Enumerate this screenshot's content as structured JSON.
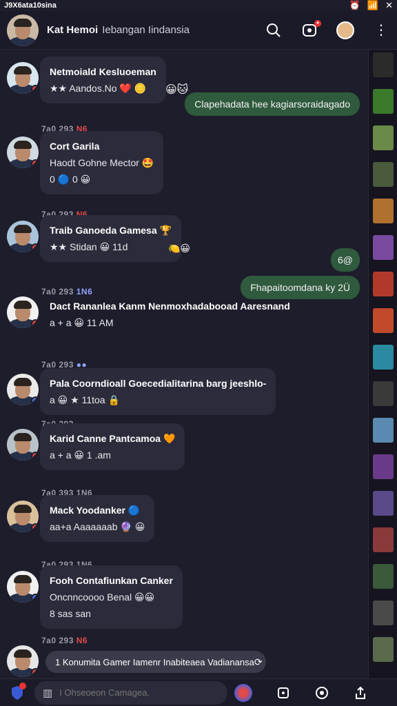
{
  "status_bar": {
    "time": "J9X6ata10sina",
    "icons": [
      "alarm-icon",
      "wifi-icon",
      "close-icon"
    ]
  },
  "header": {
    "name": "Kat Hemoi",
    "subtitle": "Iebangan Iindansia"
  },
  "colors": {
    "background": "#1e1d2b",
    "bubble": "#2c2b3b",
    "sent_bubble": "#2f5a3d",
    "accent_red": "#e24646"
  },
  "messages": [
    {
      "sender": "Netmoiald Kesluoeman",
      "line1": "★★ Aandos.No ❤️ 🪙",
      "line2": "",
      "badge": "red"
    },
    {
      "sender": "Cort Garila",
      "line1": "Haodt Gohne Mector 🤩",
      "line2": "0 🔵 0 😀",
      "badge": "red"
    },
    {
      "sender": "Traib Ganoeda Gamesa 🏆",
      "line1": "★★ Stidan 😀 11d",
      "line2": "",
      "badge": "red"
    },
    {
      "sender": "Dact Rananlea Kanm Nenmoxhadabooad Aaresnand",
      "line1": "a + a 😀 11 AM",
      "line2": "",
      "badge": "red"
    },
    {
      "sender": "Pala Coorndioall Goecedialitarina barg jeeshlo-",
      "line1": "a 😀 ★ 11toa 🔒",
      "line2": "",
      "badge": "blue"
    },
    {
      "sender": "Karid Canne Pantcamoa 🧡",
      "line1": "a + a 😀 1 .am",
      "line2": "",
      "badge": "red"
    },
    {
      "sender": "Mack Yoodanker 🔵",
      "line1": "aa+a Aaaaaaab 🔮 😀",
      "line2": "",
      "badge": "red"
    },
    {
      "sender": "Fooh Contafiunkan Canker",
      "line1": "Oncnncoooo Benal 😀😀",
      "line2": "8 sas san",
      "badge": "blue"
    },
    {
      "sender": "",
      "line1": "",
      "line2": "",
      "badge": "red"
    }
  ],
  "date_separators": [
    {
      "text": "7a0 293",
      "tag": "N6",
      "tag_color": "red"
    },
    {
      "text": "7a0 293",
      "tag": "N6",
      "tag_color": "red"
    },
    {
      "text": "7a0 293",
      "tag": "1N6",
      "tag_color": "blue"
    },
    {
      "text": "7a0 293",
      "tag": "●●",
      "tag_color": "blue"
    },
    {
      "text": "7a0 293",
      "tag": "",
      "tag_color": "blue"
    },
    {
      "text": "7a0 393 1N6",
      "tag": "",
      "tag_color": "blue"
    },
    {
      "text": "7a0 293 1N6",
      "tag": "",
      "tag_color": "blue"
    },
    {
      "text": "7a0 293",
      "tag": "N6",
      "tag_color": "red"
    }
  ],
  "sent": [
    {
      "text": "Clapehadata hee kagiarsoraidagado"
    },
    {
      "text": "6@"
    },
    {
      "text": "Fhapaitoomdana ky 2Ü"
    }
  ],
  "emoji_extras": [
    "😀🐱",
    "🍋😀"
  ],
  "toast": {
    "text": "1 Konumita Gamer Iamenr Inabiteaea Vadianansa",
    "icon": "refresh-icon"
  },
  "compose": {
    "placeholder": "I Ohseoeon Camagea."
  },
  "sidebar_thumbs": [
    {
      "color": "#2b2b2b"
    },
    {
      "color": "#3a7a2a"
    },
    {
      "color": "#6a8a4a"
    },
    {
      "color": "#4a5a3a"
    },
    {
      "color": "#b07030"
    },
    {
      "color": "#7a4aa0"
    },
    {
      "color": "#b03a2a"
    },
    {
      "color": "#c04a2a"
    },
    {
      "color": "#2a8aa0"
    },
    {
      "color": "#3a3a3a"
    },
    {
      "color": "#5a8ab0"
    },
    {
      "color": "#6a3a8a"
    },
    {
      "color": "#5a4a8a"
    },
    {
      "color": "#8a3a3a"
    },
    {
      "color": "#3a5a3a"
    },
    {
      "color": "#4a4a4a"
    },
    {
      "color": "#5a6a4a"
    }
  ]
}
